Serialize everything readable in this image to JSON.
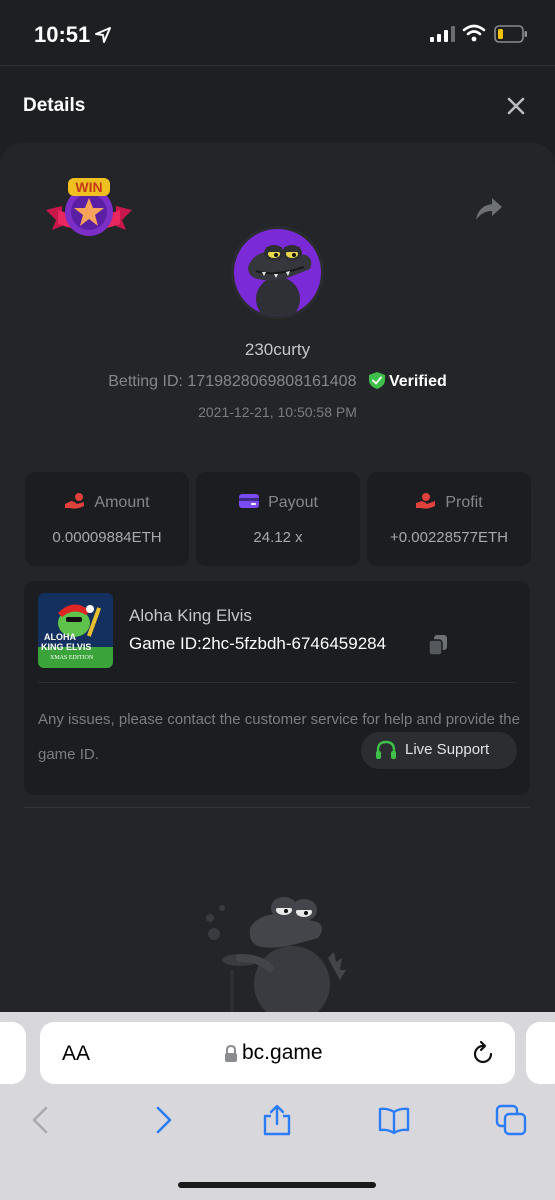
{
  "status_bar": {
    "time": "10:51"
  },
  "header": {
    "title": "Details"
  },
  "bet": {
    "badge_text": "WIN",
    "username": "230curty",
    "betting_id_label": "Betting ID:",
    "betting_id": "1719828069808161408",
    "verified_label": "Verified",
    "datetime": "2021-12-21, 10:50:58 PM"
  },
  "stats": [
    {
      "label": "Amount",
      "value": "0.00009884ETH",
      "icon": "coin-hand-icon"
    },
    {
      "label": "Payout",
      "value": "24.12 x",
      "icon": "wallet-card-icon"
    },
    {
      "label": "Profit",
      "value": "+0.00228577ETH",
      "icon": "profit-hand-icon"
    }
  ],
  "game": {
    "thumb_line1": "ALOHA",
    "thumb_line2": "KING ELVIS",
    "thumb_line3": "XMAS EDITION",
    "name": "Aloha King Elvis",
    "id_label": "Game ID:",
    "id": "2hc-5fzbdh-6746459284",
    "help_text": "Any issues, please contact the customer service for help and provide the game ID.",
    "support_label": "Live Support"
  },
  "browser": {
    "aa_label": "AA",
    "url": "bc.game"
  },
  "colors": {
    "background": "#1d1f22",
    "card": "#1b1d20",
    "verified_green": "#3fbf4a",
    "payout_purple": "#7a4bf0",
    "profit_red": "#e0413a",
    "support_green": "#3fbf4a",
    "ios_blue": "#2b7cf6"
  }
}
